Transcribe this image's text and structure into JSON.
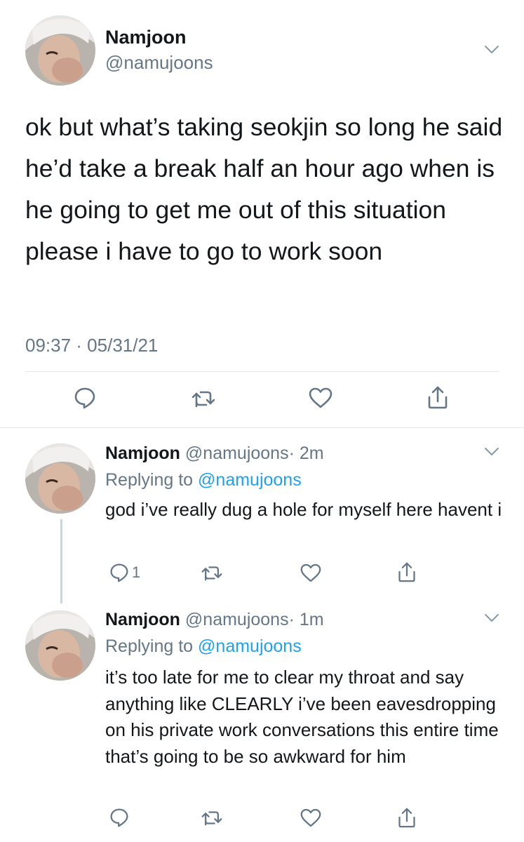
{
  "main_tweet": {
    "name": "Namjoon",
    "handle": "@namujoons",
    "text": "ok but what’s taking seokjin so long he said he’d take a break half an hour ago when is he going to get me out of this situation please i have to go to work soon",
    "timestamp": "09:37 · 05/31/21",
    "icons": [
      "reply-icon",
      "retweet-icon",
      "like-icon",
      "share-icon"
    ]
  },
  "replies": [
    {
      "name": "Namjoon",
      "handle": "@namujoons",
      "time": "· 2m",
      "replying_prefix": "Replying to",
      "replying_to": "@namujoons",
      "text": "god i’ve really dug a hole for myself here havent i",
      "reply_count": "1"
    },
    {
      "name": "Namjoon",
      "handle": "@namujoons",
      "time": "· 1m",
      "replying_prefix": "Replying to",
      "replying_to": "@namujoons",
      "text": "it’s too late for me to clear my throat and say anything like CLEARLY i’ve been eavesdropping on his private work conversations this entire time that’s going to be so awkward for him",
      "reply_count": ""
    }
  ],
  "colors": {
    "text": "#14171a",
    "secondary": "#657786",
    "link": "#1da1f2",
    "divider": "#e1e8ed",
    "icon": "#657786"
  }
}
